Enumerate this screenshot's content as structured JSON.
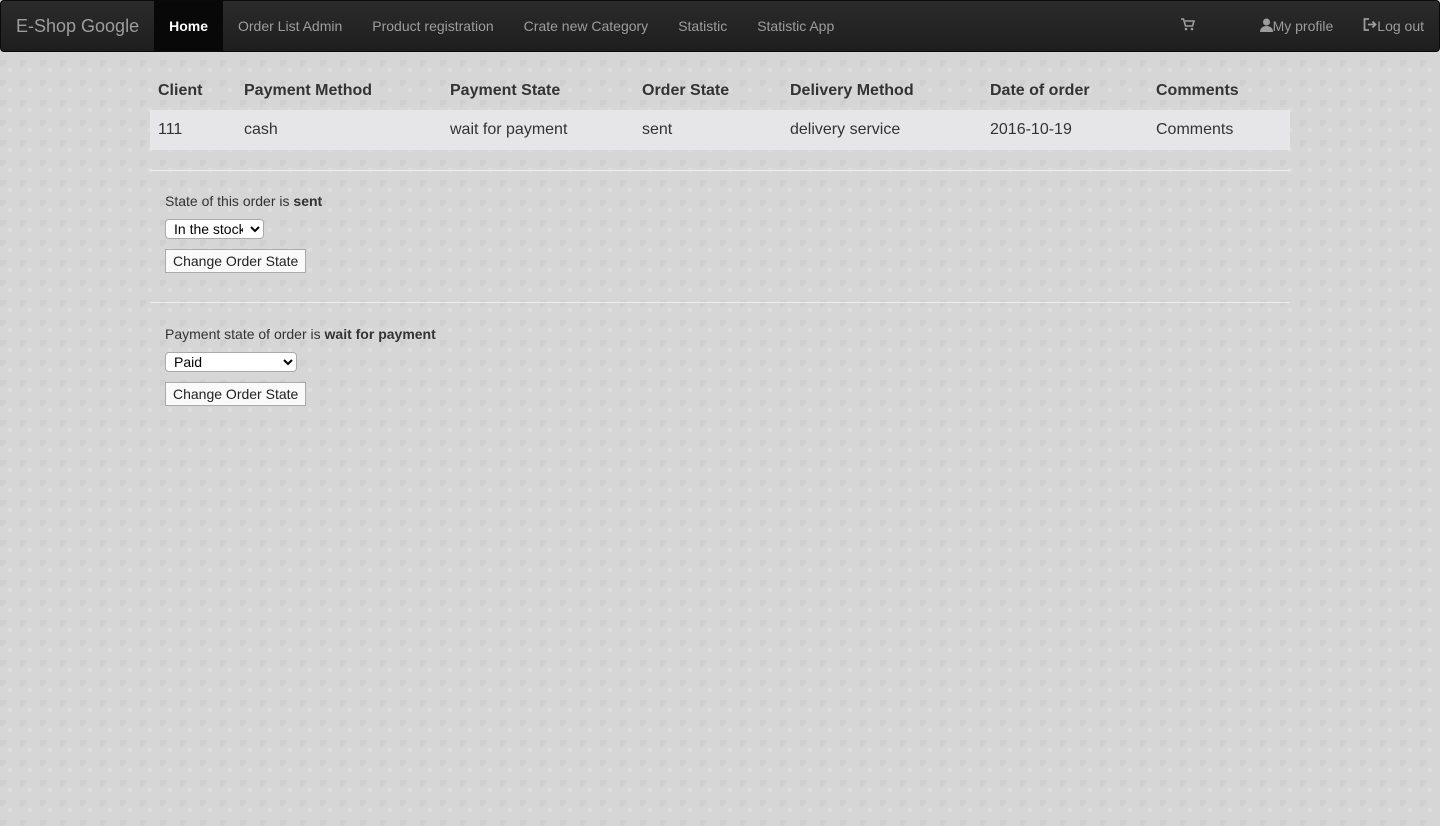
{
  "navbar": {
    "brand": "E-Shop Google",
    "items": [
      {
        "label": "Home",
        "active": true
      },
      {
        "label": "Order List Admin"
      },
      {
        "label": "Product registration"
      },
      {
        "label": "Crate new Category"
      },
      {
        "label": "Statistic"
      },
      {
        "label": "Statistic App"
      }
    ],
    "right": {
      "cart_icon": "shopping-cart-icon",
      "profile_label": "My profile",
      "profile_icon": "user-icon",
      "logout_label": "Log out",
      "logout_icon": "log-out-icon"
    }
  },
  "order_table": {
    "headers": [
      "Client",
      "Payment Method",
      "Payment State",
      "Order State",
      "Delivery Method",
      "Date of order",
      "Comments"
    ],
    "rows": [
      [
        "111",
        "cash",
        "wait for payment",
        "sent",
        "delivery service",
        "2016-10-19",
        "Comments"
      ]
    ]
  },
  "order_state": {
    "prefix": "State of this order is ",
    "value": "sent",
    "selected": "In the stock",
    "button_label": "Change Order State"
  },
  "payment_state": {
    "prefix": "Payment state of order is ",
    "value": "wait for payment",
    "selected": "Paid",
    "button_label": "Change Order State"
  }
}
